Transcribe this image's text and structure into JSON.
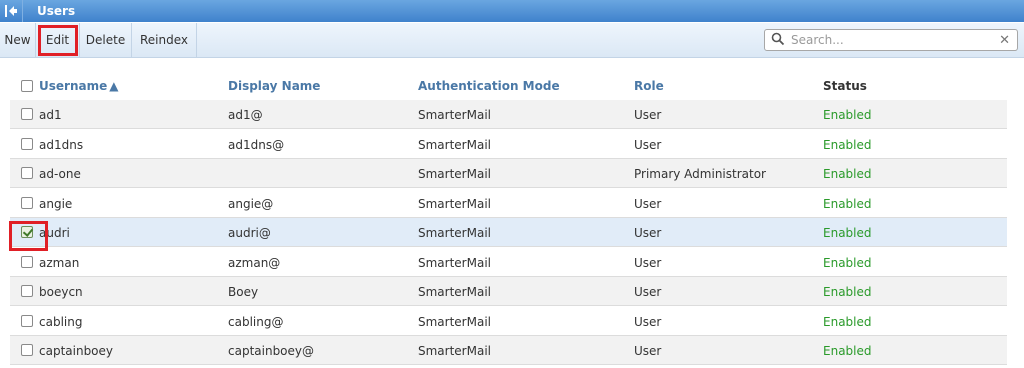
{
  "window": {
    "title": "Users"
  },
  "toolbar": {
    "new": "New",
    "edit": "Edit",
    "delete": "Delete",
    "reindex": "Reindex"
  },
  "search": {
    "placeholder": "Search...",
    "value": ""
  },
  "columns": {
    "username": "Username",
    "display_name": "Display Name",
    "auth_mode": "Authentication Mode",
    "role": "Role",
    "status": "Status"
  },
  "sort": {
    "column": "username",
    "direction": "ascending"
  },
  "rows": [
    {
      "username": "ad1",
      "display_name": "ad1@",
      "auth_mode": "SmarterMail",
      "role": "User",
      "status": "Enabled",
      "checked": false
    },
    {
      "username": "ad1dns",
      "display_name": "ad1dns@",
      "auth_mode": "SmarterMail",
      "role": "User",
      "status": "Enabled",
      "checked": false
    },
    {
      "username": "ad-one",
      "display_name": "",
      "auth_mode": "SmarterMail",
      "role": "Primary Administrator",
      "status": "Enabled",
      "checked": false
    },
    {
      "username": "angie",
      "display_name": "angie@",
      "auth_mode": "SmarterMail",
      "role": "User",
      "status": "Enabled",
      "checked": false
    },
    {
      "username": "audri",
      "display_name": "audri@",
      "auth_mode": "SmarterMail",
      "role": "User",
      "status": "Enabled",
      "checked": true
    },
    {
      "username": "azman",
      "display_name": "azman@",
      "auth_mode": "SmarterMail",
      "role": "User",
      "status": "Enabled",
      "checked": false
    },
    {
      "username": "boeycn",
      "display_name": "Boey",
      "auth_mode": "SmarterMail",
      "role": "User",
      "status": "Enabled",
      "checked": false
    },
    {
      "username": "cabling",
      "display_name": "cabling@",
      "auth_mode": "SmarterMail",
      "role": "User",
      "status": "Enabled",
      "checked": false
    },
    {
      "username": "captainboey",
      "display_name": "captainboey@",
      "auth_mode": "SmarterMail",
      "role": "User",
      "status": "Enabled",
      "checked": false
    }
  ],
  "colors": {
    "accent": "#4a78a6",
    "enabled": "#2a9a2a",
    "highlight": "#e01f26",
    "titlebar": "#3f82cc"
  },
  "icons": {
    "back": "collapse-left-icon",
    "search": "search-icon",
    "clear": "clear-icon"
  }
}
